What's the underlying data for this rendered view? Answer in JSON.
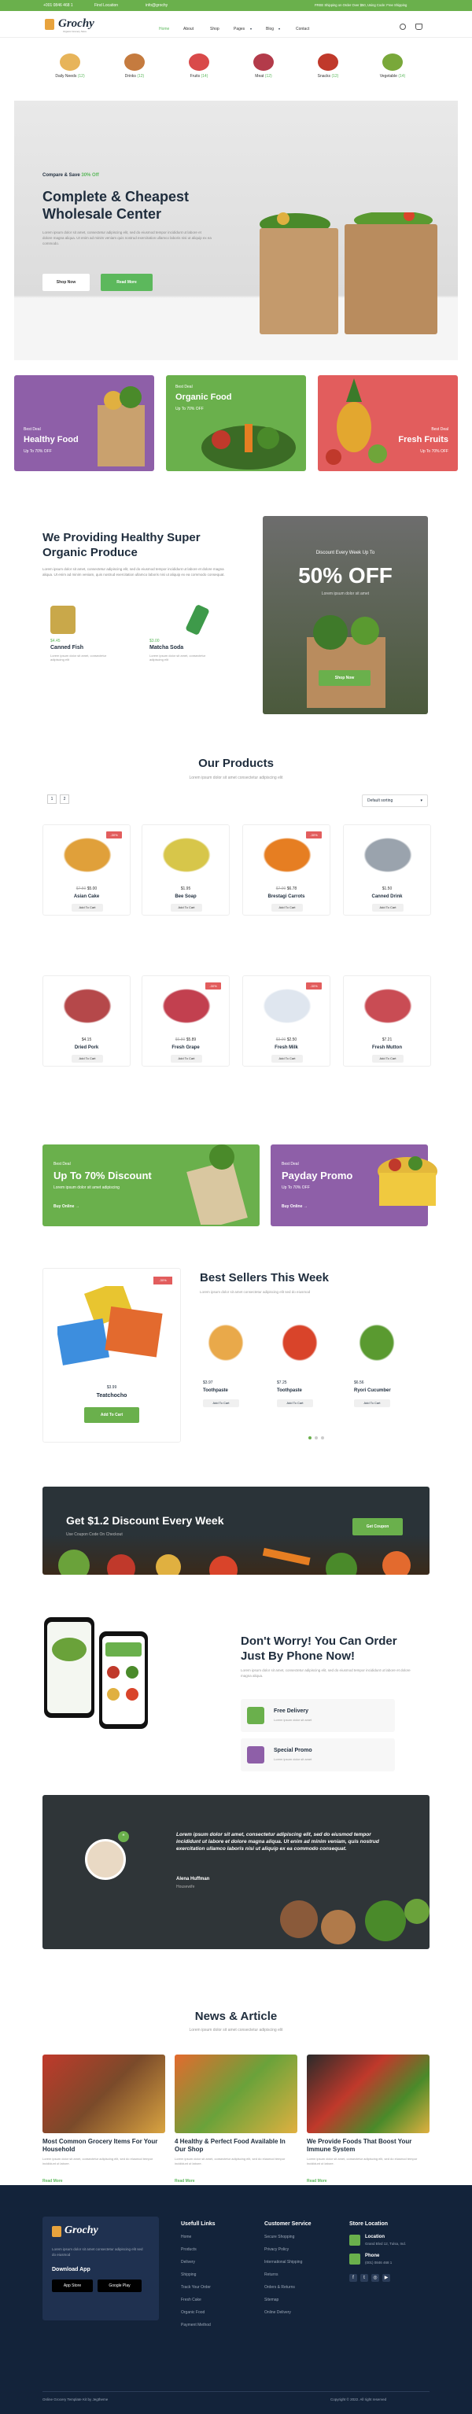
{
  "topbar": {
    "phone": "+001 0846 468 1",
    "location": "Find Location",
    "email": "info@grochy",
    "right": "FREE Shipping on Order Over $50, Using Code: Free Shipping"
  },
  "header": {
    "logo": "Grochy",
    "logo_sub": "Organic Grocery Store",
    "nav": [
      "Home",
      "About",
      "Shop",
      "Pages",
      "Blog",
      "Contact"
    ]
  },
  "categories": [
    {
      "label": "Daily Needs",
      "count": "(12)"
    },
    {
      "label": "Drinks",
      "count": "(12)"
    },
    {
      "label": "Fruits",
      "count": "(14)"
    },
    {
      "label": "Meat",
      "count": "(12)"
    },
    {
      "label": "Snacks",
      "count": "(12)"
    },
    {
      "label": "Vegetable",
      "count": "(14)"
    }
  ],
  "hero": {
    "kicker": "Compare & Save",
    "kicker_off": "30% Off",
    "title1": "Complete & Cheapest",
    "title2": "Wholesale Center",
    "desc": "Lorem ipsum dolor sit amet, consectetur adipiscing elit, sed do eiusmod tempor incididunt ut labore et dolore magna aliqua. Ut enim ad minim veniam quis nostrud exercitation ullamco laboris nisi ut aliquip ex ea commodo.",
    "btn1": "Shop Now",
    "btn2": "Read More"
  },
  "promos": [
    {
      "t1": "Best Deal",
      "t2": "Healthy Food",
      "t3": "Up To 70% OFF"
    },
    {
      "t1": "Best Deal",
      "t2": "Organic Food",
      "t3": "Up To 70% OFF"
    },
    {
      "t1": "Best Deal",
      "t2": "Fresh Fruits",
      "t3": "Up To 70% OFF"
    }
  ],
  "about": {
    "title1": "We Providing Healthy Super",
    "title2": "Organic Produce",
    "desc": "Lorem ipsum dolor sit amet, consectetur adipiscing elit, sed do eiusmod tempor incididunt ut labore et dolore magna aliqua. Ut enim ad minim veniam, quis nostrud exercitation ullamco laboris nisi ut aliquip ex ea commodo consequat.",
    "items": [
      {
        "price": "$4.45",
        "name": "Canned Fish",
        "desc": "Lorem ipsum dolor sit amet, consectetur adipiscing elit"
      },
      {
        "price": "$3.00",
        "name": "Matcha Soda",
        "desc": "Lorem ipsum dolor sit amet, consectetur adipiscing elit"
      }
    ]
  },
  "discount_card": {
    "t1": "Discount Every Week Up To",
    "t2": "50% OFF",
    "t3": "Lorem ipsum dolor sit amet",
    "btn": "Shop Now"
  },
  "products": {
    "title": "Our Products",
    "sub": "Lorem ipsum dolor sit amet consectetur adipiscing elit",
    "sort": "Default sorting",
    "pages": [
      "1",
      "2"
    ],
    "add": "Add To Cart",
    "items": [
      {
        "name": "Asian Cake",
        "price": "$5.00",
        "old": "$7.50",
        "badge": "-30%"
      },
      {
        "name": "Bee Soap",
        "price": "$1.95",
        "old": "",
        "badge": ""
      },
      {
        "name": "Brestagi Carrots",
        "price": "$6.78",
        "old": "$7.00",
        "badge": "-30%"
      },
      {
        "name": "Canned Drink",
        "price": "$1.50",
        "old": "",
        "badge": ""
      },
      {
        "name": "Dried Pork",
        "price": "$4.15",
        "old": "",
        "badge": ""
      },
      {
        "name": "Fresh Grape",
        "price": "$5.89",
        "old": "$6.80",
        "badge": "-30%"
      },
      {
        "name": "Fresh Milk",
        "price": "$2.50",
        "old": "$3.00",
        "badge": "-30%"
      },
      {
        "name": "Fresh Mutton",
        "price": "$7.21",
        "old": "",
        "badge": ""
      }
    ]
  },
  "deals": [
    {
      "t1": "Best Deal",
      "t2": "Up To 70% Discount",
      "t3": "Lorem ipsum dolor sit amet adipiscing",
      "link": "Buy Online"
    },
    {
      "t1": "Best Deal",
      "t2": "Payday Promo",
      "t3": "Up To 70% OFF",
      "link": "Buy Online"
    }
  ],
  "bestsellers": {
    "title": "Best Sellers This Week",
    "sub": "Lorem ipsum dolor sit amet consectetur adipiscing elit sed do eiusmod",
    "featured": {
      "name": "Teatchocho",
      "price": "$3.99",
      "badge": "-30%",
      "btn": "Add To Cart"
    },
    "items": [
      {
        "name": "Toothpaste",
        "price": "$3.97"
      },
      {
        "name": "Toothpaste",
        "price": "$7.25"
      },
      {
        "name": "Ryori Cucumber",
        "price": "$6.56"
      }
    ],
    "add": "Add To Cart"
  },
  "banner": {
    "title": "Get $1.2 Discount Every Week",
    "sub": "Use Coupon Code On Checkout",
    "btn": "Get Coupon"
  },
  "phone": {
    "title1": "Don't Worry! You Can Order",
    "title2": "Just By Phone Now!",
    "desc": "Lorem ipsum dolor sit amet, consectetur adipiscing elit, sed do eiusmod tempor incididunt ut labore et dolore magna aliqua.",
    "f1": "Free Delivery",
    "f1s": "Lorem ipsum dolor sit amet",
    "f2": "Special Promo",
    "f2s": "Lorem ipsum dolor sit amet"
  },
  "testimonial": {
    "quote": "Lorem ipsum dolor sit amet, consectetur adipiscing elit, sed do eiusmod tempor incididunt ut labore et dolore magna aliqua. Ut enim ad minim veniam, quis nostrud exercitation ullamco laboris nisi ut aliquip ex ea commodo consequat.",
    "name": "Alena Huffman",
    "role": "Housewife"
  },
  "news": {
    "title": "News & Article",
    "sub": "Lorem ipsum dolor sit amet consectetur adipiscing elit",
    "read": "Read More",
    "items": [
      {
        "title": "Most Common Grocery Items For Your Household",
        "desc": "Lorem ipsum dolor sit amet, consectetur adipiscing elit, sed do eiusmod tempor incididunt ut labore."
      },
      {
        "title": "4 Healthy & Perfect Food Available In Our Shop",
        "desc": "Lorem ipsum dolor sit amet, consectetur adipiscing elit, sed do eiusmod tempor incididunt ut labore."
      },
      {
        "title": "We Provide Foods That Boost Your Immune System",
        "desc": "Lorem ipsum dolor sit amet, consectetur adipiscing elit, sed do eiusmod tempor incididunt ut labore."
      }
    ]
  },
  "footer": {
    "logo": "Grochy",
    "desc": "Lorem ipsum dolor sit amet consectetur adipiscing elit sed do eiusmod",
    "app_title": "Download App",
    "app_store": "App Store",
    "google_play": "Google Play",
    "col1": {
      "title": "Usefull Links",
      "links": [
        "Home",
        "Products",
        "Delivery",
        "Shipping",
        "Track Your Order",
        "Fresh Cake",
        "Organic Food",
        "Payment Method"
      ]
    },
    "col2": {
      "title": "Customer Service",
      "links": [
        "Secure Shopping",
        "Privacy Policy",
        "International Shipping",
        "Returns",
        "Orders & Returns",
        "Sitemap",
        "Online Delivery"
      ]
    },
    "col3": {
      "title": "Store Location",
      "loc_label": "Location",
      "loc": "Grand Blvd 12, Tulsa, Ind.",
      "phone_label": "Phone",
      "phone": "(001) 0846 468 1"
    },
    "bottom_left": "Online Grocery Template Kit by Jegtheme",
    "bottom_right": "Copyright © 2022. All right reserved"
  }
}
